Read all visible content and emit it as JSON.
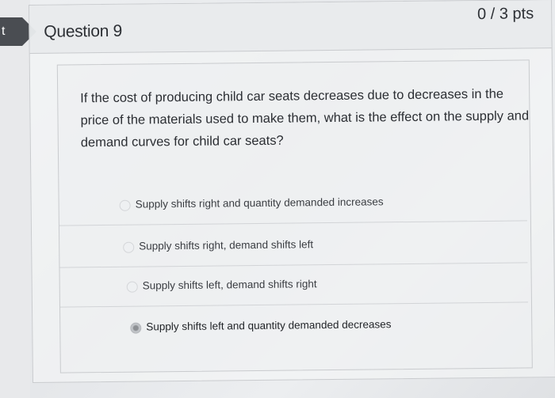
{
  "left_tab": {
    "label": "t"
  },
  "question": {
    "title": "Question 9",
    "points": "0 / 3 pts",
    "text": "If the cost of producing child car seats decreases due to decreases in the price of the materials used to make them, what is the effect on the supply and demand curves for child car seats?",
    "answers": [
      {
        "label": "Supply shifts right and quantity demanded increases",
        "selected": false
      },
      {
        "label": "Supply shifts right, demand shifts left",
        "selected": false
      },
      {
        "label": "Supply shifts left, demand shifts right",
        "selected": false
      },
      {
        "label": "Supply shifts left and quantity demanded decreases",
        "selected": true
      }
    ]
  }
}
